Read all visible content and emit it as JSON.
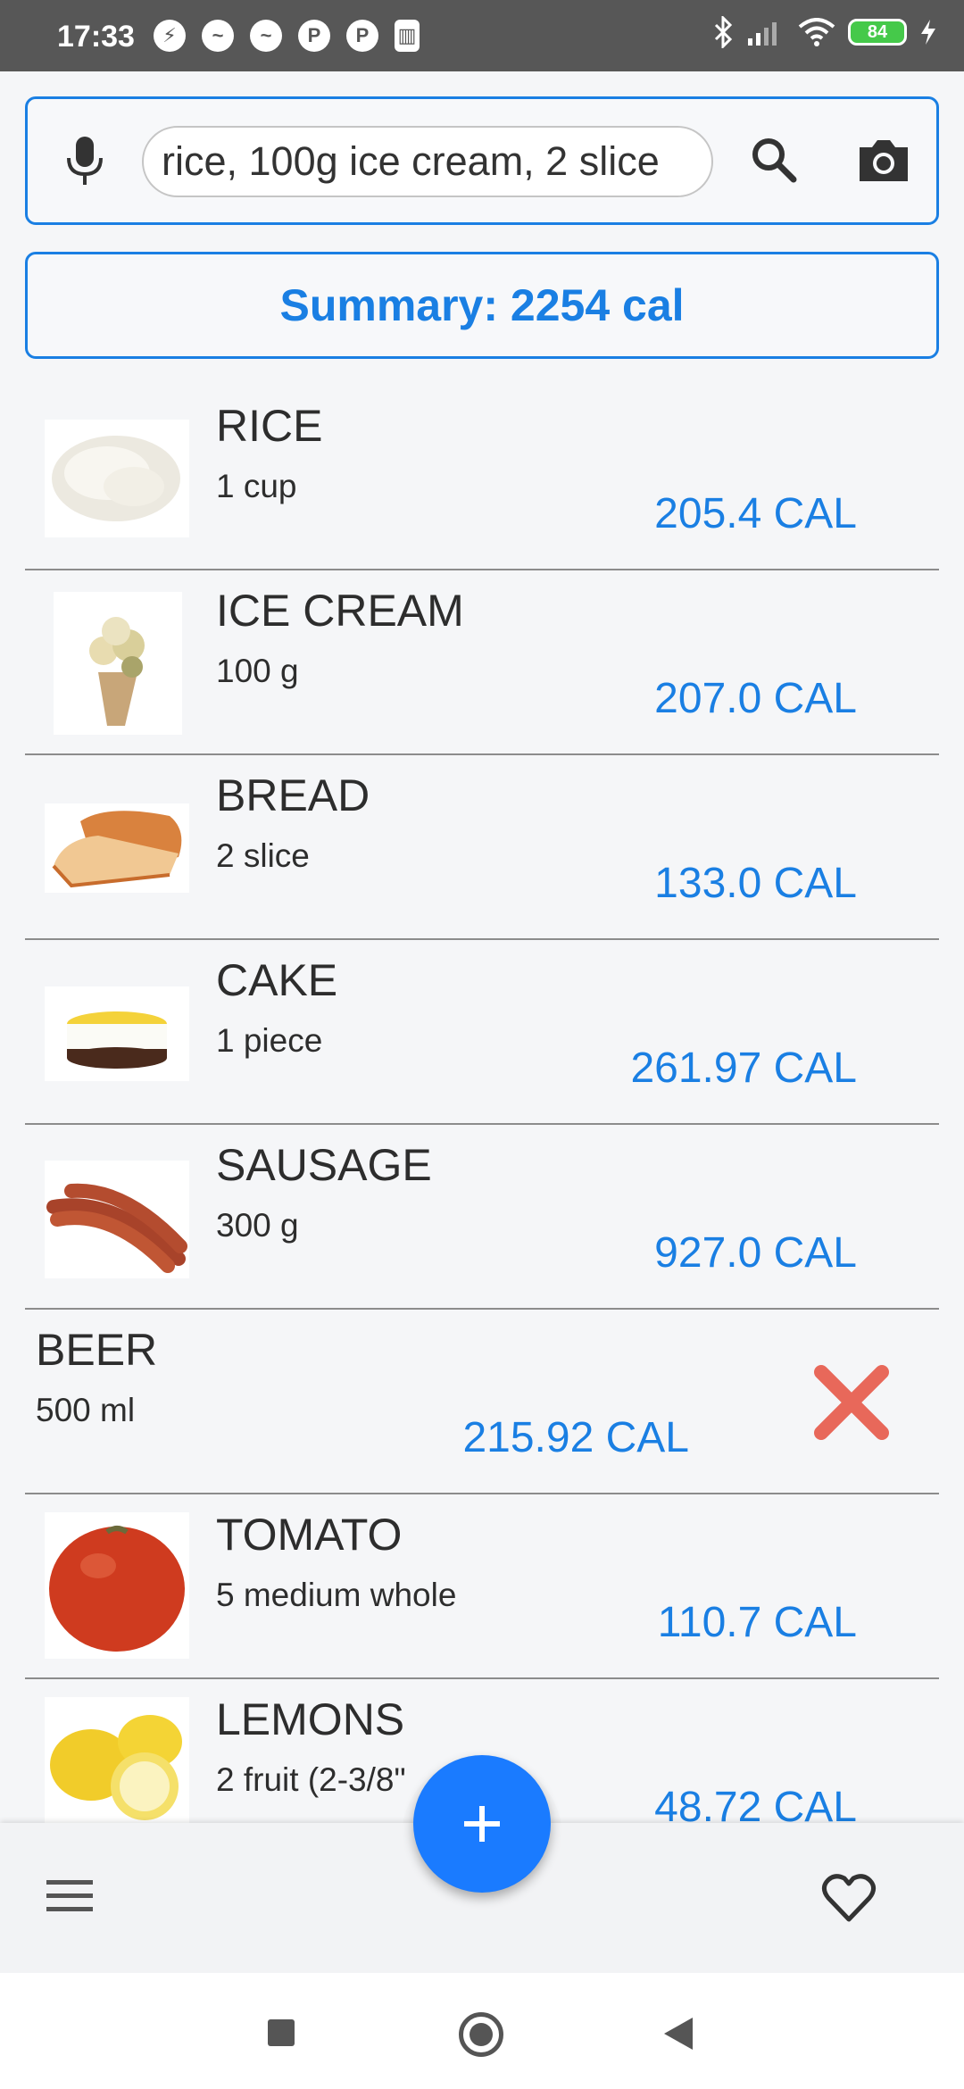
{
  "status_bar": {
    "time": "17:33",
    "battery": "84",
    "left_icons": [
      "shield-icon",
      "messenger-icon",
      "messenger-icon",
      "p-icon",
      "p-icon",
      "trash-icon"
    ],
    "right_icons": [
      "bluetooth-icon",
      "signal-icon",
      "wifi-icon",
      "battery-icon",
      "charging-icon"
    ]
  },
  "search": {
    "value": "rice, 100g ice cream, 2 slice"
  },
  "summary": {
    "label": "Summary: 2254 cal"
  },
  "foods": [
    {
      "name": "RICE",
      "qty": "1 cup",
      "cal": "205.4 CAL",
      "image": "rice"
    },
    {
      "name": "ICE CREAM",
      "qty": "100 g",
      "cal": "207.0 CAL",
      "image": "ice-cream"
    },
    {
      "name": "BREAD",
      "qty": "2 slice",
      "cal": "133.0 CAL",
      "image": "bread"
    },
    {
      "name": "CAKE",
      "qty": "1 piece",
      "cal": "261.97 CAL",
      "image": "cake"
    },
    {
      "name": "SAUSAGE",
      "qty": "300 g",
      "cal": "927.0 CAL",
      "image": "sausage"
    },
    {
      "name": "BEER",
      "qty": "500 ml",
      "cal": "215.92 CAL",
      "image": null,
      "deletable": true
    },
    {
      "name": "TOMATO",
      "qty": "5 medium whole",
      "cal": "110.7 CAL",
      "image": "tomato"
    },
    {
      "name": "LEMONS",
      "qty": "2 fruit (2-3/8\"",
      "cal": "48.72 CAL",
      "image": "lemons"
    }
  ],
  "colors": {
    "accent": "#1a7fe3",
    "fab": "#1a7bff",
    "delete": "#e8685a",
    "statusbar": "#575757"
  }
}
